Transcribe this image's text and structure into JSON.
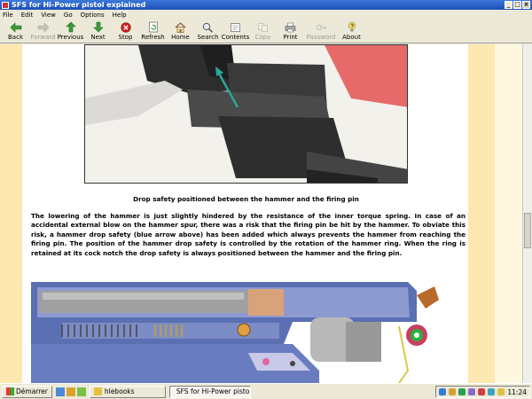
{
  "window": {
    "title": "SFS for Hi-Power pistol explained",
    "min_label": "_",
    "max_label": "□",
    "close_label": "×"
  },
  "menu": [
    "File",
    "Edit",
    "View",
    "Go",
    "Options",
    "Help"
  ],
  "toolbar": [
    {
      "label": "Back",
      "icon": "back-arrow-icon",
      "enabled": true
    },
    {
      "label": "Forward",
      "icon": "forward-arrow-icon",
      "enabled": false
    },
    {
      "label": "Previous",
      "icon": "up-arrow-icon",
      "enabled": true
    },
    {
      "label": "Next",
      "icon": "down-arrow-icon",
      "enabled": true
    },
    {
      "label": "Stop",
      "icon": "stop-icon",
      "enabled": true
    },
    {
      "label": "Refresh",
      "icon": "refresh-icon",
      "enabled": true
    },
    {
      "label": "Home",
      "icon": "home-icon",
      "enabled": true
    },
    {
      "label": "Search",
      "icon": "search-icon",
      "enabled": true
    },
    {
      "label": "Contents",
      "icon": "contents-icon",
      "enabled": true
    },
    {
      "label": "Copy",
      "icon": "copy-icon",
      "enabled": false
    },
    {
      "label": "Print",
      "icon": "print-icon",
      "enabled": true
    },
    {
      "label": "Password",
      "icon": "password-icon",
      "enabled": false
    },
    {
      "label": "About",
      "icon": "about-icon",
      "enabled": true
    }
  ],
  "page": {
    "caption": "Drop safety positioned between the hammer and the firing pin",
    "paragraph": "The lowering of the hammer is just slightly hindered by the resistance of the inner torque spring. In case of an accidental external blow on the hammer spur, there was a risk that the firing pin be hit by the hammer. To obviate this risk, a hammer drop safety (blue arrow above) has been added which always prevents the hammer from reaching the firing pin. The position of the hammer drop safety is controlled by the rotation of the hammer ring. When the ring is retained at its cock notch the drop safety is always positioned between the hammer and the firing pin."
  },
  "taskbar": {
    "start_label": "Démarrer",
    "tasks": [
      {
        "label": "hlebooks",
        "active": false
      },
      {
        "label": "SFS for Hi-Power pisto...",
        "active": true
      }
    ],
    "clock": "11:24"
  },
  "colors": {
    "gutter": "#fce8b0",
    "titlebar": "#1d4fb8",
    "diagram_frame": "#5a6cb0",
    "arrow": "#2aa89a"
  }
}
